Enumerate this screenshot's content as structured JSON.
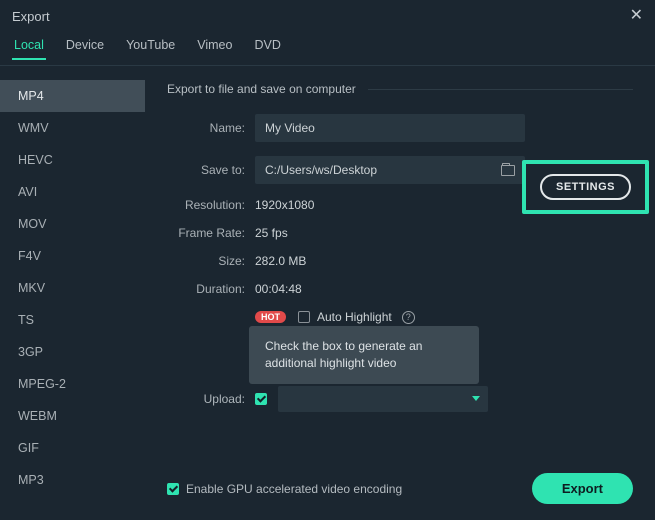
{
  "window": {
    "title": "Export"
  },
  "tabs": [
    "Local",
    "Device",
    "YouTube",
    "Vimeo",
    "DVD"
  ],
  "tabs_active_index": 0,
  "formats": [
    "MP4",
    "WMV",
    "HEVC",
    "AVI",
    "MOV",
    "F4V",
    "MKV",
    "TS",
    "3GP",
    "MPEG-2",
    "WEBM",
    "GIF",
    "MP3"
  ],
  "formats_active_index": 0,
  "section": {
    "heading": "Export to file and save on computer"
  },
  "fields": {
    "name_label": "Name:",
    "name_value": "My Video",
    "saveto_label": "Save to:",
    "saveto_value": "C:/Users/ws/Desktop",
    "resolution_label": "Resolution:",
    "resolution_value": "1920x1080",
    "framerate_label": "Frame Rate:",
    "framerate_value": "25 fps",
    "size_label": "Size:",
    "size_value": "282.0 MB",
    "duration_label": "Duration:",
    "duration_value": "00:04:48"
  },
  "settings_button": "SETTINGS",
  "hot_badge": "HOT",
  "auto_highlight_label": "Auto Highlight",
  "tooltip_text": "Check the box to generate an additional highlight video",
  "upload_label": "Upload:",
  "gpu_label": "Enable GPU accelerated video encoding",
  "export_button": "Export"
}
